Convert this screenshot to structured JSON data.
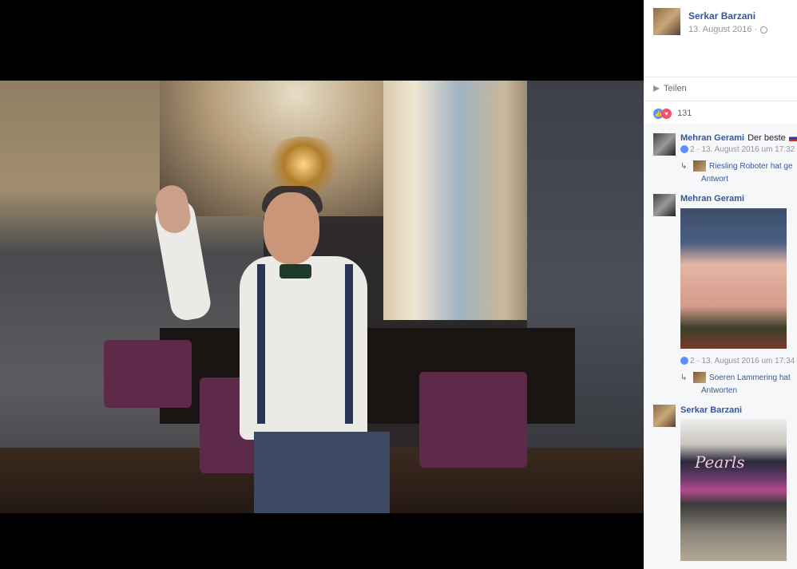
{
  "post": {
    "author": "Serkar Barzani",
    "date": "13. August 2016 ·",
    "share_label": "Teilen",
    "reaction_count": "131"
  },
  "comments": [
    {
      "author": "Mehran Gerami",
      "text": "Der beste",
      "likes": "2",
      "timestamp": "13. August 2016 um 17:32",
      "reply_line1": "Riesling Roboter hat ge",
      "reply_line2": "Antwort"
    },
    {
      "author": "Mehran Gerami",
      "likes": "2",
      "timestamp": "13. August 2016 um 17:34",
      "reply_line1": "Soeren Lammering hat",
      "reply_line2": "Antworten"
    },
    {
      "author": "Serkar Barzani",
      "image_text": "Pearls"
    }
  ],
  "colors": {
    "link": "#365899",
    "like": "#5890ff",
    "love": "#f25268"
  }
}
